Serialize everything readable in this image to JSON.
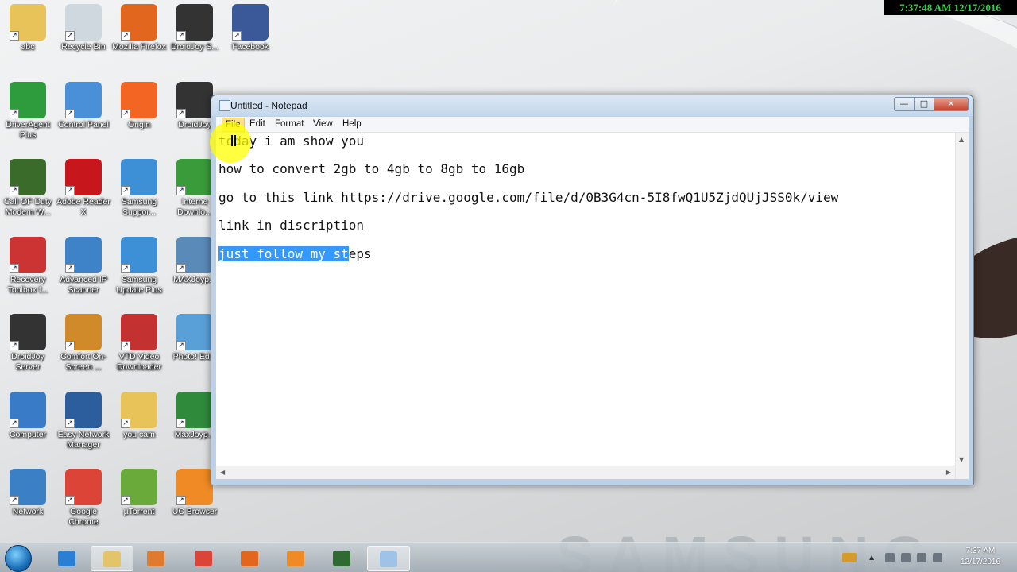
{
  "clock_banner": "7:37:48 AM 12/17/2016",
  "desktop": {
    "icons": [
      {
        "label": "abc",
        "icon": "folder-user-icon",
        "color": "#e8c35a"
      },
      {
        "label": "Recycle Bin",
        "icon": "recycle-bin-icon",
        "color": "#cfd8de"
      },
      {
        "label": "Mozilla Firefox",
        "icon": "firefox-icon",
        "color": "#e2661e"
      },
      {
        "label": "DroidJoy S...",
        "icon": "droidjoy-icon",
        "color": "#333333"
      },
      {
        "label": "Facebook",
        "icon": "facebook-icon",
        "color": "#3b5998"
      },
      {
        "label": "DriverAgent Plus",
        "icon": "driveragent-icon",
        "color": "#2e9b3c"
      },
      {
        "label": "Control Panel",
        "icon": "control-panel-icon",
        "color": "#4a90d9"
      },
      {
        "label": "Origin",
        "icon": "origin-icon",
        "color": "#f26522"
      },
      {
        "label": "DroidJoy",
        "icon": "droidjoy-icon",
        "color": "#333333"
      },
      {
        "label": "Call OF Duty Modern W...",
        "icon": "cod-icon",
        "color": "#3b6b2a"
      },
      {
        "label": "Adobe Reader X",
        "icon": "adobe-reader-icon",
        "color": "#c8161d"
      },
      {
        "label": "Samsung Suppor...",
        "icon": "samsung-support-icon",
        "color": "#3d8fd6"
      },
      {
        "label": "Interne Downlo...",
        "icon": "idm-icon",
        "color": "#3a9b3a"
      },
      {
        "label": "Recovery Toolbox f...",
        "icon": "recovery-toolbox-icon",
        "color": "#cc3333"
      },
      {
        "label": "Advanced IP Scanner",
        "icon": "ip-scanner-icon",
        "color": "#3e82c7"
      },
      {
        "label": "Samsung Update Plus",
        "icon": "samsung-update-icon",
        "color": "#3d8fd6"
      },
      {
        "label": "MAXJoyp...",
        "icon": "maxjoypad-icon",
        "color": "#5a8ab8"
      },
      {
        "label": "DroidJoy Server",
        "icon": "droidjoy-server-icon",
        "color": "#333333"
      },
      {
        "label": "Comfort On-Screen ...",
        "icon": "keyboard-icon",
        "color": "#d08a2a"
      },
      {
        "label": "VTD Video Downloader",
        "icon": "vtd-downloader-icon",
        "color": "#c43131"
      },
      {
        "label": "Photo! Ed...",
        "icon": "photo-editor-icon",
        "color": "#5aa0d8"
      },
      {
        "label": "Computer",
        "icon": "computer-icon",
        "color": "#3a7bc8"
      },
      {
        "label": "Easy Network Manager",
        "icon": "network-manager-icon",
        "color": "#2c5e9e"
      },
      {
        "label": "you cam",
        "icon": "folder-icon",
        "color": "#e8c35a"
      },
      {
        "label": "MaxJoyp...",
        "icon": "maxjoypad-icon",
        "color": "#2f8a3b"
      },
      {
        "label": "Network",
        "icon": "network-icon",
        "color": "#3b7fc4"
      },
      {
        "label": "Google Chrome",
        "icon": "chrome-icon",
        "color": "#db4437"
      },
      {
        "label": "µTorrent",
        "icon": "utorrent-icon",
        "color": "#6aaa3a"
      },
      {
        "label": "UC Browser",
        "icon": "uc-browser-icon",
        "color": "#f08a24"
      }
    ]
  },
  "notepad": {
    "title": "Untitled - Notepad",
    "menu": {
      "file": "File",
      "edit": "Edit",
      "format": "Format",
      "view": "View",
      "help": "Help"
    },
    "window_buttons": {
      "minimize": "—",
      "maximize": "□",
      "close": "✕"
    },
    "lines": {
      "l1": "today i am show you",
      "l2": "how to convert 2gb to 4gb to 8gb to 16gb",
      "l3": "go to this link https://drive.google.com/file/d/0B3G4cn-5I8fwQ1U5ZjdQUjJSS0k/view",
      "l4": "link in discription",
      "l5_selected": "just follow my st",
      "l5_rest": "eps"
    }
  },
  "taskbar": {
    "apps": [
      {
        "name": "internet-explorer",
        "color": "#2a7fd4"
      },
      {
        "name": "file-explorer",
        "color": "#e4c46a"
      },
      {
        "name": "media-player",
        "color": "#e07a2e"
      },
      {
        "name": "chrome",
        "color": "#db4437"
      },
      {
        "name": "firefox",
        "color": "#e2661e"
      },
      {
        "name": "uc-browser",
        "color": "#f08a24"
      },
      {
        "name": "gamepad-app",
        "color": "#2f6a33"
      },
      {
        "name": "notepad",
        "color": "#9fc3e6"
      }
    ],
    "clock_time": "7:37 AM",
    "clock_date": "12/17/2016"
  },
  "wallpaper_brand": "SAMSUNG"
}
